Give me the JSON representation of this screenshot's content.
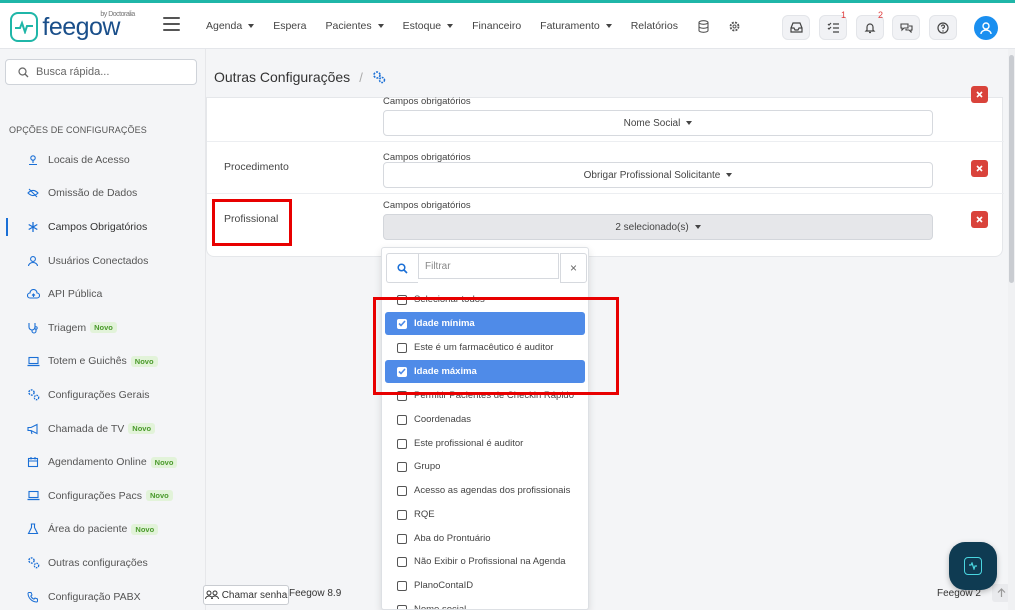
{
  "brand": {
    "name": "feegow",
    "sub": "by Doctoralia",
    "color": "#1fb6a8"
  },
  "nav": {
    "items": [
      {
        "label": "Agenda",
        "caret": true
      },
      {
        "label": "Espera",
        "caret": false
      },
      {
        "label": "Pacientes",
        "caret": true
      },
      {
        "label": "Estoque",
        "caret": true
      },
      {
        "label": "Financeiro",
        "caret": false
      },
      {
        "label": "Faturamento",
        "caret": true
      },
      {
        "label": "Relatórios",
        "caret": false
      }
    ],
    "icons": [
      "database-icon",
      "gear-icon"
    ]
  },
  "toolbar": {
    "tasks_badge": "1",
    "notifications_badge": "2"
  },
  "sidebar": {
    "search_placeholder": "Busca rápida...",
    "heading": "OPÇÕES DE CONFIGURAÇÕES",
    "items": [
      {
        "label": "Locais de Acesso",
        "icon": "location-icon",
        "novo": false,
        "active": false
      },
      {
        "label": "Omissão de Dados",
        "icon": "eye-off-icon",
        "novo": false,
        "active": false
      },
      {
        "label": "Campos Obrigatórios",
        "icon": "asterisk-icon",
        "novo": false,
        "active": true
      },
      {
        "label": "Usuários Conectados",
        "icon": "user-icon",
        "novo": false,
        "active": false
      },
      {
        "label": "API Pública",
        "icon": "cloud-icon",
        "novo": false,
        "active": false
      },
      {
        "label": "Triagem",
        "icon": "stethoscope-icon",
        "novo": true,
        "active": false
      },
      {
        "label": "Totem e Guichês",
        "icon": "laptop-icon",
        "novo": true,
        "active": false
      },
      {
        "label": "Configurações Gerais",
        "icon": "gears-icon",
        "novo": false,
        "active": false
      },
      {
        "label": "Chamada de TV",
        "icon": "megaphone-icon",
        "novo": true,
        "active": false
      },
      {
        "label": "Agendamento Online",
        "icon": "calendar-icon",
        "novo": true,
        "active": false
      },
      {
        "label": "Configurações Pacs",
        "icon": "laptop-icon",
        "novo": true,
        "active": false
      },
      {
        "label": "Área do paciente",
        "icon": "flask-icon",
        "novo": true,
        "active": false
      },
      {
        "label": "Outras configurações",
        "icon": "gears-icon",
        "novo": false,
        "active": false
      },
      {
        "label": "Configuração PABX",
        "icon": "phone-icon",
        "novo": false,
        "active": false
      }
    ],
    "novo_label": "Novo"
  },
  "page": {
    "title": "Outras Configurações",
    "separator": "/"
  },
  "rows": [
    {
      "label": "",
      "field_label": "Campos obrigatórios",
      "value": "Nome Social"
    },
    {
      "label": "Procedimento",
      "field_label": "Campos obrigatórios",
      "value": "Obrigar Profissional Solicitante"
    },
    {
      "label": "Profissional",
      "field_label": "Campos obrigatórios",
      "value": "2 selecionado(s)"
    }
  ],
  "dropdown": {
    "filter_placeholder": "Filtrar",
    "clear_label": "×",
    "options": [
      {
        "label": "Selecionar todos",
        "checked": false
      },
      {
        "label": "Idade mínima",
        "checked": true
      },
      {
        "label": "Este é um farmacêutico é auditor",
        "checked": false
      },
      {
        "label": "Idade máxima",
        "checked": true
      },
      {
        "label": "Permitir Pacientes de Checkin Rápido",
        "checked": false
      },
      {
        "label": "Coordenadas",
        "checked": false
      },
      {
        "label": "Este profissional é auditor",
        "checked": false
      },
      {
        "label": "Grupo",
        "checked": false
      },
      {
        "label": "Acesso as agendas dos profissionais",
        "checked": false
      },
      {
        "label": "RQE",
        "checked": false
      },
      {
        "label": "Aba do Prontuário",
        "checked": false
      },
      {
        "label": "Não Exibir o Profissional na Agenda",
        "checked": false
      },
      {
        "label": "PlanoContaID",
        "checked": false
      },
      {
        "label": "Nome social",
        "checked": false
      }
    ]
  },
  "footer": {
    "call_button": "Chamar senha",
    "version": "Feegow 8.9",
    "right_label": "Feegow 2"
  },
  "colors": {
    "accent": "#1a6fd6",
    "selected_option": "#4f8be8",
    "delete": "#d9433b",
    "highlight_box": "#e80000",
    "novo_bg": "#e2f3d9"
  }
}
